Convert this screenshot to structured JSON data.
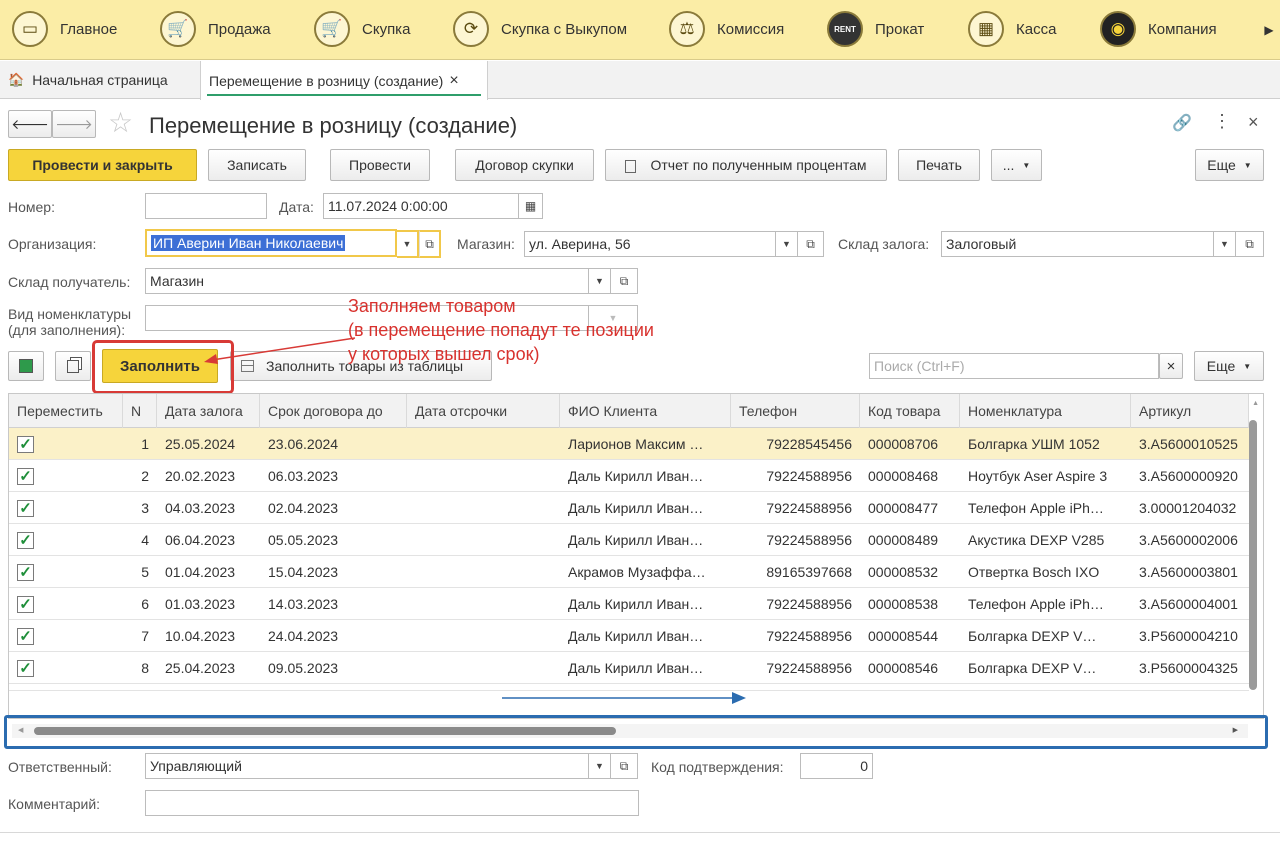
{
  "nav": {
    "items": [
      {
        "label": "Главное",
        "icon": "home-icon",
        "glyph": "▭"
      },
      {
        "label": "Продажа",
        "icon": "cart-icon",
        "glyph": "🛒"
      },
      {
        "label": "Скупка",
        "icon": "basket-icon",
        "glyph": "🛒"
      },
      {
        "label": "Скупка с Выкупом",
        "icon": "refresh-icon",
        "glyph": "⟳"
      },
      {
        "label": "Комиссия",
        "icon": "scales-icon",
        "glyph": "⚖"
      },
      {
        "label": "Прокат",
        "icon": "rent-icon",
        "glyph": "RENT"
      },
      {
        "label": "Касса",
        "icon": "cash-register-icon",
        "glyph": "▦"
      },
      {
        "label": "Компания",
        "icon": "company-logo-icon",
        "glyph": "◉"
      }
    ],
    "more_glyph": "▶"
  },
  "tabs": {
    "home": "Начальная страница",
    "active": "Перемещение в розницу (создание)",
    "close": "×",
    "home_glyph": "🏠"
  },
  "form": {
    "title": "Перемещение в розницу (создание)",
    "back": "🡐",
    "forward": "🡒",
    "star": "☆",
    "link": "🔗",
    "menu": "⋮",
    "close": "×",
    "toolbar": {
      "post_close": "Провести и закрыть",
      "save": "Записать",
      "post": "Провести",
      "contract": "Договор скупки",
      "report": "Отчет по полученным процентам",
      "print": "Печать",
      "dots": "...",
      "more": "Еще"
    },
    "number_label": "Номер:",
    "number_value": "",
    "date_label": "Дата:",
    "date_value": "11.07.2024  0:00:00",
    "org_label": "Организация:",
    "org_value": "ИП Аверин Иван Николаевич",
    "shop_label": "Магазин:",
    "shop_value": "ул. Аверина, 56",
    "pawn_label": "Склад залога:",
    "pawn_value": "Залоговый",
    "recv_label": "Склад получатель:",
    "recv_value": "Магазин",
    "nom_label_1": "Вид номенклатуры",
    "nom_label_2": "(для заполнения):",
    "nom_value": "",
    "fill": "Заполнить",
    "fill_table": "Заполнить товары из таблицы",
    "search_placeholder": "Поиск (Ctrl+F)",
    "search_clear": "×",
    "more2": "Еще",
    "responsible_label": "Ответственный:",
    "responsible_value": "Управляющий",
    "code_label": "Код подтверждения:",
    "code_value": "0",
    "comment_label": "Комментарий:",
    "comment_value": ""
  },
  "annotation": {
    "line1": "Заполняем товаром",
    "line2": "(в перемещение попадут те позиции",
    "line3": "у которых вышел срок)"
  },
  "table": {
    "columns": [
      "Переместить",
      "N",
      "Дата залога",
      "Срок договора до",
      "Дата отсрочки",
      "ФИО Клиента",
      "Телефон",
      "Код товара",
      "Номенклатура",
      "Артикул"
    ],
    "rows": [
      {
        "check": "✓",
        "n": "1",
        "date": "25.05.2024",
        "term": "23.06.2024",
        "defer": "",
        "client": "Ларионов Максим …",
        "phone": "79228545456",
        "code": "000008706",
        "item": "Болгарка УШМ 1052",
        "art": "3.A5600010525"
      },
      {
        "check": "✓",
        "n": "2",
        "date": "20.02.2023",
        "term": "06.03.2023",
        "defer": "",
        "client": "Даль Кирилл Иван…",
        "phone": "79224588956",
        "code": "000008468",
        "item": "Ноутбук Aser Aspire 3",
        "art": "3.A5600000920"
      },
      {
        "check": "✓",
        "n": "3",
        "date": "04.03.2023",
        "term": "02.04.2023",
        "defer": "",
        "client": "Даль Кирилл Иван…",
        "phone": "79224588956",
        "code": "000008477",
        "item": "Телефон Apple iPh…",
        "art": "3.00001204032"
      },
      {
        "check": "✓",
        "n": "4",
        "date": "06.04.2023",
        "term": "05.05.2023",
        "defer": "",
        "client": "Даль Кирилл Иван…",
        "phone": "79224588956",
        "code": "000008489",
        "item": "Акустика DEXP V285",
        "art": "3.A5600002006"
      },
      {
        "check": "✓",
        "n": "5",
        "date": "01.04.2023",
        "term": "15.04.2023",
        "defer": "",
        "client": "Акрамов Музаффа…",
        "phone": "89165397668",
        "code": "000008532",
        "item": "Отвертка Bosch IXO",
        "art": "3.A5600003801"
      },
      {
        "check": "✓",
        "n": "6",
        "date": "01.03.2023",
        "term": "14.03.2023",
        "defer": "",
        "client": "Даль Кирилл Иван…",
        "phone": "79224588956",
        "code": "000008538",
        "item": "Телефон Apple iPh…",
        "art": "3.A5600004001"
      },
      {
        "check": "✓",
        "n": "7",
        "date": "10.04.2023",
        "term": "24.04.2023",
        "defer": "",
        "client": "Даль Кирилл Иван…",
        "phone": "79224588956",
        "code": "000008544",
        "item": "Болгарка DEXP V…",
        "art": "3.P5600004210"
      },
      {
        "check": "✓",
        "n": "8",
        "date": "25.04.2023",
        "term": "09.05.2023",
        "defer": "",
        "client": "Даль Кирилл Иван…",
        "phone": "79224588956",
        "code": "000008546",
        "item": "Болгарка DEXP V…",
        "art": "3.P5600004325"
      }
    ]
  },
  "colors": {
    "accent": "#f6d43b",
    "annotation": "#d8322e",
    "highlight": "#2b6cb0"
  }
}
